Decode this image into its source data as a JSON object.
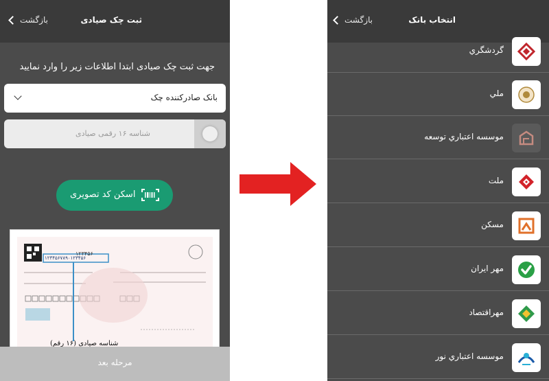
{
  "left_screen": {
    "back_label": "بازگشت",
    "title": "ثبت چک صیادی",
    "instruction": "جهت ثبت چک صیادی ابتدا اطلاعات زیر را وارد نمایید",
    "bank_select_label": "بانک صادرکننده چک",
    "id_field_placeholder": "شناسه ۱۶ رقمی صیادی",
    "scan_button_label": "اسکن کد تصویری",
    "cheque": {
      "number": "۱۲۳۴۵۶",
      "sayad_id": "۱۲۳۴۵۶۷۸۹۰۱۲۳۴۵۶",
      "annotation": "شناسه صیادی (۱۶ رقم)"
    },
    "next_button_label": "مرحله بعد"
  },
  "right_screen": {
    "back_label": "بازگشت",
    "title": "انتخاب بانک",
    "banks": [
      {
        "name": "گردشگري",
        "icon": "gardeshgari-logo-icon"
      },
      {
        "name": "ملي",
        "icon": "melli-logo-icon"
      },
      {
        "name": "موسسه اعتباري توسعه",
        "icon": "tosee-logo-icon"
      },
      {
        "name": "ملت",
        "icon": "mellat-logo-icon"
      },
      {
        "name": "مسکن",
        "icon": "maskan-logo-icon"
      },
      {
        "name": "مهر ايران",
        "icon": "mehr-iran-logo-icon"
      },
      {
        "name": "مهراقتصاد",
        "icon": "mehr-eghtesad-logo-icon"
      },
      {
        "name": "موسسه اعتباري نور",
        "icon": "noor-logo-icon"
      }
    ]
  },
  "colors": {
    "screen_bg": "#4b4b4b",
    "topbar_bg": "#3a3a3a",
    "scan_button": "#1a9b72",
    "arrow": "#e32222"
  }
}
